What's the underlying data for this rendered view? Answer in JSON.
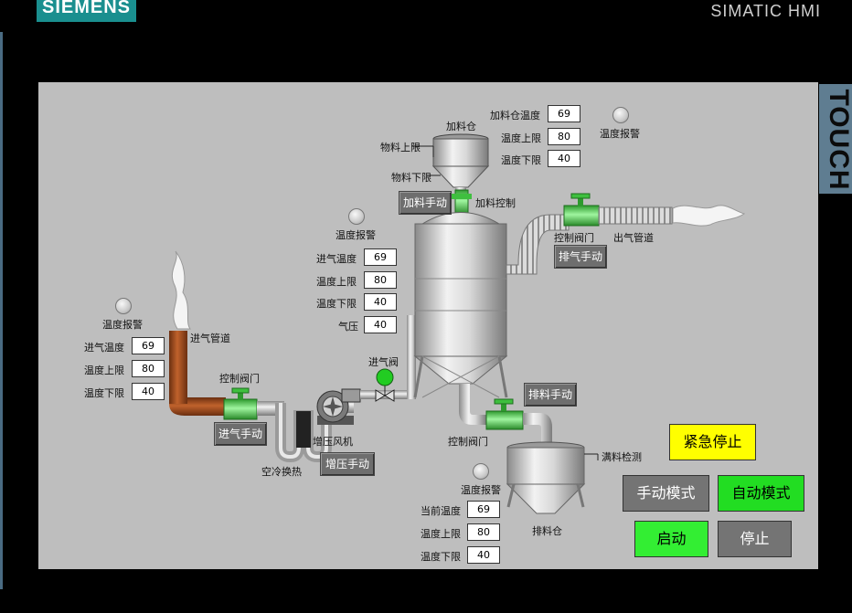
{
  "header": {
    "brand": "SIEMENS",
    "product": "SIMATIC HMI",
    "touch": "TOUCH"
  },
  "colors": {
    "pipe_orange": "#a0522d",
    "valve_green": "#5fd35f",
    "emergency_yellow": "#ffff00",
    "auto_green": "#22dd22",
    "start_green": "#33ee33",
    "panel_gray": "#bebebe"
  },
  "left": {
    "alarm": "温度报警",
    "inlet_pipe": "进气管道",
    "rows": [
      {
        "label": "进气温度",
        "value": "69"
      },
      {
        "label": "温度上限",
        "value": "80"
      },
      {
        "label": "温度下限",
        "value": "40"
      }
    ],
    "valve": "控制阀门",
    "manual_btn": "进气手动",
    "cooler": "空冷换热"
  },
  "fan": {
    "label": "增压风机",
    "manual_btn": "增压手动",
    "valve": "进气阀"
  },
  "mid": {
    "alarm": "温度报警",
    "rows": [
      {
        "label": "进气温度",
        "value": "69"
      },
      {
        "label": "温度上限",
        "value": "80"
      },
      {
        "label": "温度下限",
        "value": "40"
      },
      {
        "label": "气压",
        "value": "40"
      }
    ]
  },
  "hopper": {
    "title": "加料仓",
    "upper_level": "物料上限",
    "lower_level": "物料下限",
    "feed_btn": "加料手动",
    "feed_ctrl": "加料控制",
    "rows": [
      {
        "label": "加料仓温度",
        "value": "69"
      },
      {
        "label": "温度上限",
        "value": "80"
      },
      {
        "label": "温度下限",
        "value": "40"
      }
    ],
    "alarm": "温度报警"
  },
  "outlet": {
    "valve": "控制阀门",
    "pipe": "出气管道",
    "manual_btn": "排气手动"
  },
  "discharge": {
    "manual_btn": "排料手动",
    "valve": "控制阀门",
    "full_detect": "满料检测",
    "bin": "排料仓",
    "alarm": "温度报警",
    "rows": [
      {
        "label": "当前温度",
        "value": "69"
      },
      {
        "label": "温度上限",
        "value": "80"
      },
      {
        "label": "温度下限",
        "value": "40"
      }
    ]
  },
  "controls": {
    "emergency": "紧急停止",
    "manual_mode": "手动模式",
    "auto_mode": "自动模式",
    "start": "启动",
    "stop": "停止"
  }
}
